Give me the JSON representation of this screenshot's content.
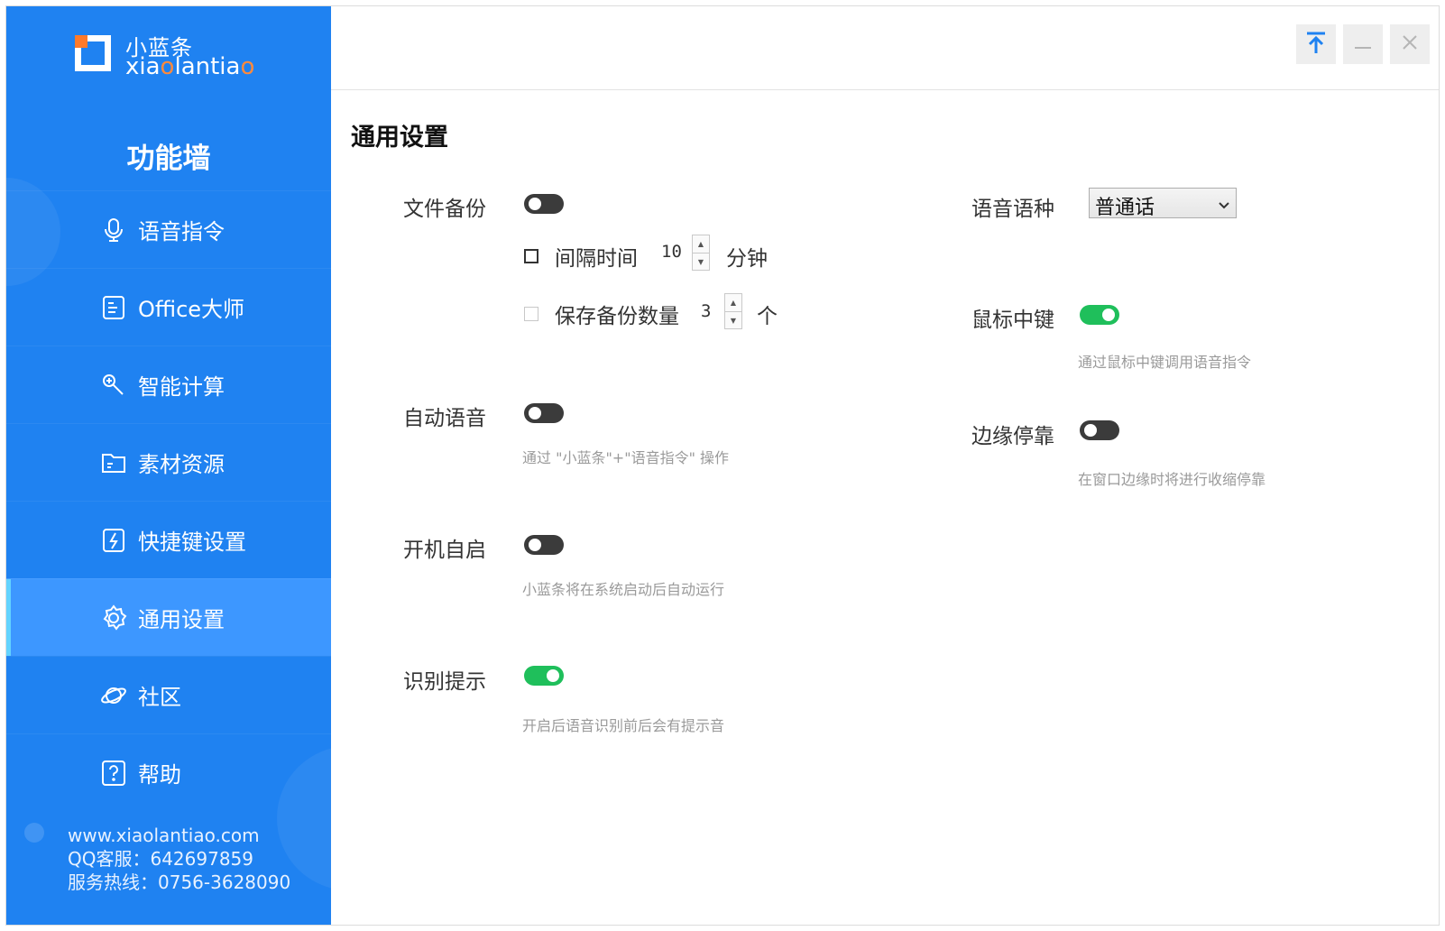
{
  "sidebar": {
    "logo_cn": "小蓝条",
    "logo_en_parts": [
      "xia",
      "o",
      "lanti",
      "a",
      "o"
    ],
    "title": "功能墙",
    "items": [
      {
        "label": "语音指令",
        "icon": "microphone-icon"
      },
      {
        "label": "Office大师",
        "icon": "document-icon"
      },
      {
        "label": "智能计算",
        "icon": "wrench-icon"
      },
      {
        "label": "素材资源",
        "icon": "folder-icon"
      },
      {
        "label": "快捷键设置",
        "icon": "lightning-icon"
      },
      {
        "label": "通用设置",
        "icon": "gear-icon",
        "active": true
      },
      {
        "label": "社区",
        "icon": "planet-icon"
      },
      {
        "label": "帮助",
        "icon": "help-icon"
      }
    ],
    "footer": {
      "website": "www.xiaolantiao.com",
      "qq": "QQ客服：642697859",
      "hotline": "服务热线：0756-3628090"
    }
  },
  "titlebar": {
    "pin_icon": "pin-top-icon",
    "minimize_icon": "minimize-icon",
    "close_icon": "close-icon"
  },
  "main": {
    "title": "通用设置",
    "file_backup": {
      "label": "文件备份",
      "enabled": false
    },
    "interval": {
      "label": "间隔时间",
      "value": "10",
      "unit": "分钟",
      "checked": false
    },
    "backup_count": {
      "label": "保存备份数量",
      "value": "3",
      "unit": "个",
      "checked": false,
      "disabled": true
    },
    "auto_voice": {
      "label": "自动语音",
      "enabled": false,
      "desc": "通过 \"小蓝条\"+\"语音指令\" 操作"
    },
    "auto_start": {
      "label": "开机自启",
      "enabled": false,
      "desc": "小蓝条将在系统启动后自动运行"
    },
    "recognition_prompt": {
      "label": "识别提示",
      "enabled": true,
      "desc": "开启后语音识别前后会有提示音"
    },
    "language": {
      "label": "语音语种",
      "selected": "普通话"
    },
    "middle_key": {
      "label": "鼠标中键",
      "enabled": true,
      "desc": "通过鼠标中键调用语音指令"
    },
    "edge_dock": {
      "label": "边缘停靠",
      "enabled": false,
      "desc": "在窗口边缘时将进行收缩停靠"
    }
  },
  "colors": {
    "sidebar": "#1f82f1",
    "sidebar_active": "#3d97ff",
    "toggle_on": "#1fbf5b",
    "toggle_off": "#3b3b3b",
    "logo_accent": "#ff7a2a"
  }
}
